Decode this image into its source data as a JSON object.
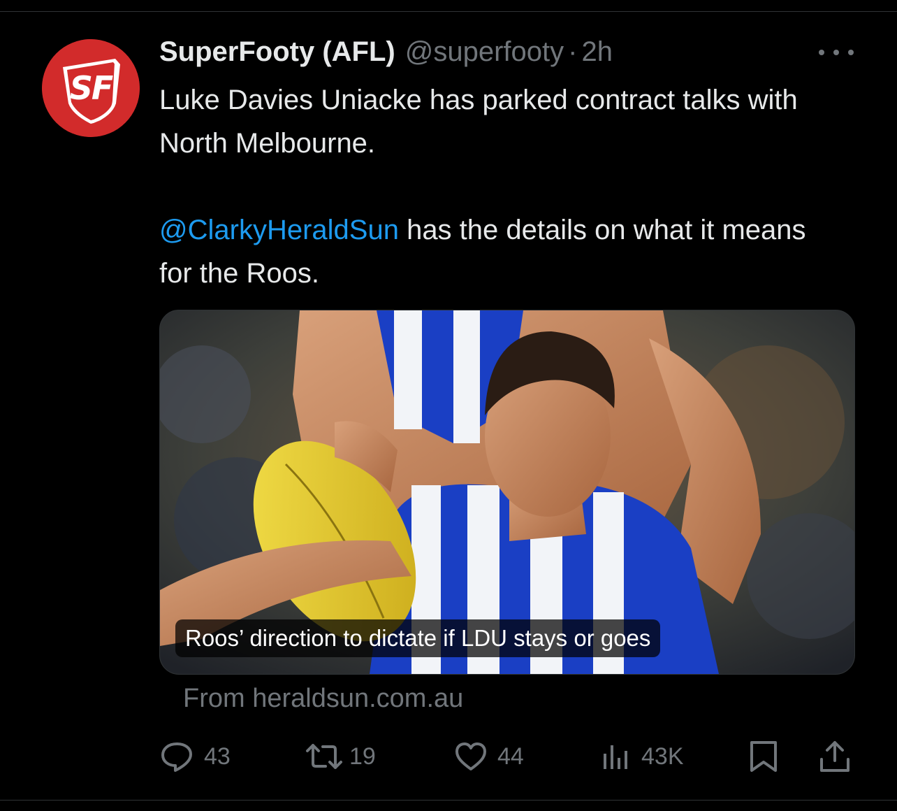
{
  "tweet": {
    "display_name": "SuperFooty (AFL)",
    "handle": "@superfooty",
    "separator": "·",
    "time": "2h",
    "avatar_logo_text": "SF",
    "text_line1": "Luke Davies Uniacke has parked contract talks with North Melbourne.",
    "mention": "@ClarkyHeraldSun",
    "text_line2": " has the details on what it means for the Roos."
  },
  "card": {
    "caption": "Roos’ direction to dictate if LDU stays or goes",
    "source": "From heraldsun.com.au",
    "image_alt": "North Melbourne player in blue and white striped guernsey holding a yellow football while being tackled"
  },
  "actions": {
    "replies": "43",
    "reposts": "19",
    "likes": "44",
    "views": "43K"
  },
  "colors": {
    "background": "#000000",
    "text": "#e7e9ea",
    "muted": "#71767b",
    "link": "#1d9bf0",
    "avatar_brand": "#d22b2b"
  }
}
